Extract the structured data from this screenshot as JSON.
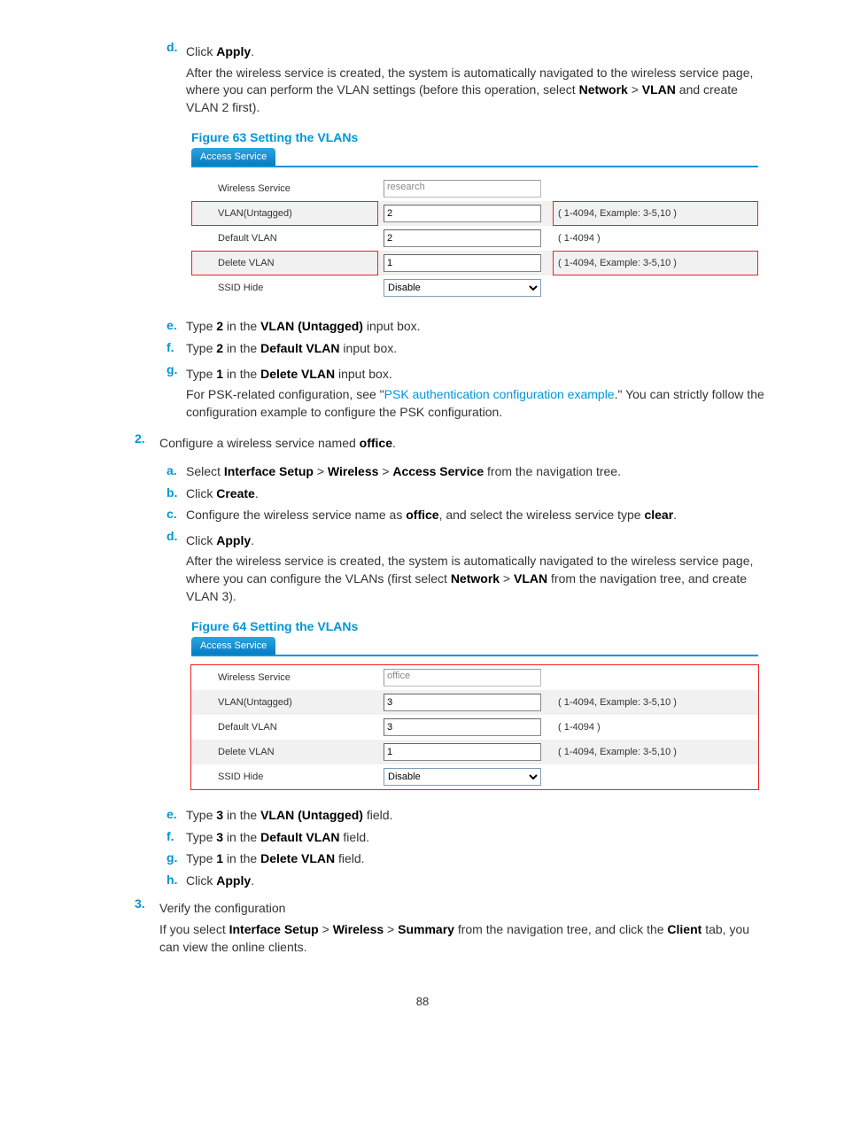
{
  "page_number": "88",
  "steps1": {
    "d_label": "d.",
    "d_text_prefix": "Click ",
    "d_text_bold": "Apply",
    "d_text_suffix": ".",
    "d_para": "After the wireless service is created, the system is automatically navigated to the wireless service page, where you can perform the VLAN settings (before this operation, select ",
    "d_para_b1": "Network",
    "d_para_mid": " > ",
    "d_para_b2": "VLAN",
    "d_para_end": " and create VLAN 2 first)."
  },
  "figure63": {
    "caption": "Figure 63 Setting the VLANs",
    "tab": "Access Service",
    "rows": {
      "wireless_label": "Wireless Service",
      "wireless_value": "research",
      "vlan_untagged_label": "VLAN(Untagged)",
      "vlan_untagged_value": "2",
      "vlan_untagged_hint": "( 1-4094, Example: 3-5,10 )",
      "default_vlan_label": "Default VLAN",
      "default_vlan_value": "2",
      "default_vlan_hint": "( 1-4094 )",
      "delete_vlan_label": "Delete VLAN",
      "delete_vlan_value": "1",
      "delete_vlan_hint": "( 1-4094, Example: 3-5,10 )",
      "ssid_hide_label": "SSID Hide",
      "ssid_hide_value": "Disable"
    }
  },
  "steps1b": {
    "e_label": "e.",
    "e_pre": "Type ",
    "e_b1": "2",
    "e_mid": " in the ",
    "e_b2": "VLAN (Untagged)",
    "e_end": " input box.",
    "f_label": "f.",
    "f_pre": "Type ",
    "f_b1": "2",
    "f_mid": " in the ",
    "f_b2": "Default VLAN",
    "f_end": " input box.",
    "g_label": "g.",
    "g_pre": "Type ",
    "g_b1": "1",
    "g_mid": " in the ",
    "g_b2": "Delete VLAN",
    "g_end": " input box.",
    "g_para_pre": "For PSK-related configuration, see \"",
    "g_para_link": "PSK authentication configuration example",
    "g_para_post": ".\" You can strictly follow the configuration example to configure the PSK configuration."
  },
  "step2": {
    "num": "2.",
    "text_pre": "Configure a wireless service named ",
    "text_b": "office",
    "text_end": ".",
    "a_label": "a.",
    "a_pre": "Select ",
    "a_b1": "Interface Setup",
    "a_g1": " > ",
    "a_b2": "Wireless",
    "a_g2": " > ",
    "a_b3": "Access Service",
    "a_end": " from the navigation tree.",
    "b_label": "b.",
    "b_pre": "Click ",
    "b_b1": "Create",
    "b_end": ".",
    "c_label": "c.",
    "c_pre": "Configure the wireless service name as ",
    "c_b1": "office",
    "c_mid": ", and select the wireless service type ",
    "c_b2": "clear",
    "c_end": ".",
    "d_label": "d.",
    "d_pre": "Click ",
    "d_b1": "Apply",
    "d_end": ".",
    "d_para_pre": "After the wireless service is created, the system is automatically navigated to the wireless service page, where you can configure the VLANs (first select ",
    "d_para_b1": "Network",
    "d_para_g": " > ",
    "d_para_b2": "VLAN",
    "d_para_end": " from the navigation tree, and create VLAN 3)."
  },
  "figure64": {
    "caption": "Figure 64 Setting the VLANs",
    "tab": "Access Service",
    "rows": {
      "wireless_label": "Wireless Service",
      "wireless_value": "office",
      "vlan_untagged_label": "VLAN(Untagged)",
      "vlan_untagged_value": "3",
      "vlan_untagged_hint": "( 1-4094, Example: 3-5,10 )",
      "default_vlan_label": "Default VLAN",
      "default_vlan_value": "3",
      "default_vlan_hint": "( 1-4094 )",
      "delete_vlan_label": "Delete VLAN",
      "delete_vlan_value": "1",
      "delete_vlan_hint": "( 1-4094, Example: 3-5,10 )",
      "ssid_hide_label": "SSID Hide",
      "ssid_hide_value": "Disable"
    }
  },
  "steps2b": {
    "e_label": "e.",
    "e_pre": "Type ",
    "e_b1": "3",
    "e_mid": " in the ",
    "e_b2": "VLAN (Untagged)",
    "e_end": " field.",
    "f_label": "f.",
    "f_pre": "Type ",
    "f_b1": "3",
    "f_mid": " in the ",
    "f_b2": "Default VLAN",
    "f_end": " field.",
    "g_label": "g.",
    "g_pre": "Type ",
    "g_b1": "1",
    "g_mid": " in the ",
    "g_b2": "Delete VLAN",
    "g_end": " field.",
    "h_label": "h.",
    "h_pre": "Click ",
    "h_b1": "Apply",
    "h_end": "."
  },
  "step3": {
    "num": "3.",
    "text": "Verify the configuration",
    "para_pre": "If you select ",
    "para_b1": "Interface Setup",
    "para_g1": " > ",
    "para_b2": "Wireless",
    "para_g2": " > ",
    "para_b3": "Summary",
    "para_mid": " from the navigation tree, and click the ",
    "para_b4": "Client",
    "para_end": " tab, you can view the online clients."
  }
}
